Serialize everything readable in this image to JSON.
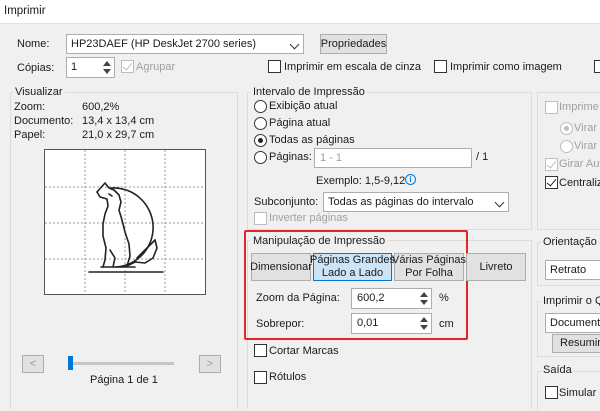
{
  "window": {
    "title": "Imprimir"
  },
  "printer": {
    "name_label": "Nome:",
    "name_value": "HP23DAEF (HP DeskJet 2700 series)",
    "properties_button": "Propriedades",
    "copies_label": "Cópias:",
    "copies_value": "1",
    "collate_label": "Agrupar",
    "grayscale_label": "Imprimir em escala de cinza",
    "as_image_label": "Imprimir como imagem"
  },
  "preview": {
    "group_title": "Visualizar",
    "zoom_label": "Zoom:",
    "zoom_value": "600,2%",
    "document_label": "Documento:",
    "document_value": "13,4 x 13,4 cm",
    "paper_label": "Papel:",
    "paper_value": "21,0 x 29,7 cm",
    "page_indicator": "Página 1 de 1",
    "prev_glyph": "<",
    "next_glyph": ">",
    "slider_position": 0
  },
  "range": {
    "group_title": "Intervalo de Impressão",
    "current_view": "Exibição atual",
    "current_page": "Página atual",
    "all_pages": "Todas as páginas",
    "pages_label": "Páginas:",
    "pages_placeholder": "1 - 1",
    "pages_total": "/ 1",
    "example": "Exemplo: 1,5-9,12",
    "info_glyph": "i",
    "subset_label": "Subconjunto:",
    "subset_value": "Todas as páginas do intervalo",
    "reverse_label": "Inverter páginas"
  },
  "handling": {
    "group_title": "Manipulação de Impressão",
    "size_button": "Dimensionar",
    "poster_button_line1": "Páginas Grandes",
    "poster_button_line2": "Lado a Lado",
    "multiple_button_line1": "Várias Páginas",
    "multiple_button_line2": "Por Folha",
    "booklet_button": "Livreto",
    "zoom_label": "Zoom da Página:",
    "zoom_value": "600,2",
    "zoom_unit": "%",
    "overlap_label": "Sobrepor:",
    "overlap_value": "0,01",
    "overlap_unit": "cm",
    "cut_marks_label": "Cortar Marcas",
    "labels_label": "Rótulos",
    "highlight_color": "#e3262c"
  },
  "right_panel": {
    "print_both_label": "Imprime e",
    "flip_long_label": "Virar na",
    "flip_short_label": "Virar na",
    "auto_rotate_label": "Girar Auto",
    "center_label": "Centraliza",
    "orientation_title": "Orientação",
    "orientation_value": "Retrato",
    "print_what_title": "Imprimir o Q",
    "document_combo": "Documento",
    "summary_button": "Resumir C",
    "output_title": "Saída",
    "simulate_label": "Simular a"
  }
}
